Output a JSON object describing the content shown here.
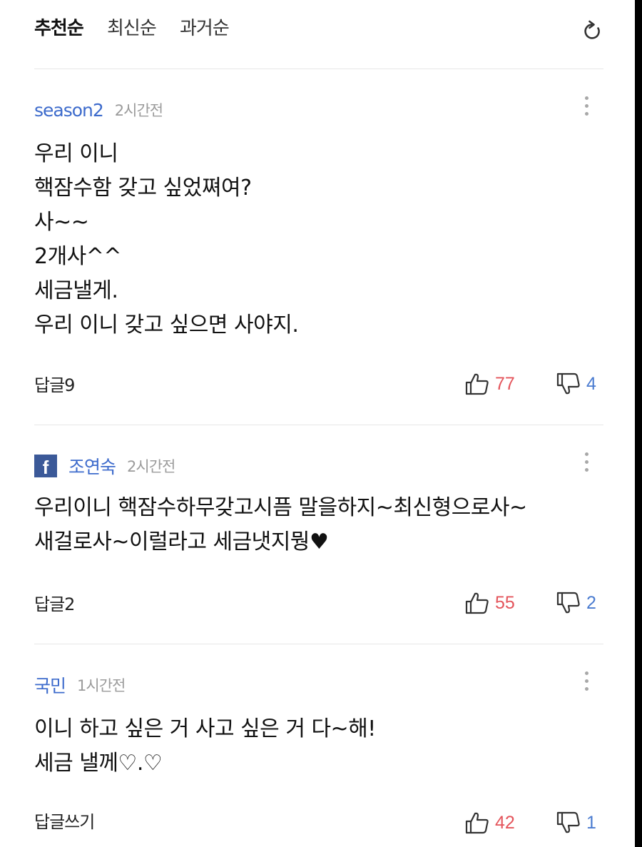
{
  "sort": {
    "tabs": [
      "추천순",
      "최신순",
      "과거순"
    ],
    "active_index": 0
  },
  "icons": {
    "refresh": "refresh-icon",
    "more": "more-vertical-icon",
    "like": "thumbs-up-icon",
    "dislike": "thumbs-down-icon",
    "facebook": "facebook-icon"
  },
  "colors": {
    "author": "#3d6bcc",
    "like_count": "#e4555c",
    "dislike_count": "#4a7bd0",
    "facebook": "#3b5998"
  },
  "comments": [
    {
      "author": "season2",
      "time": "2시간전",
      "facebook": false,
      "text": "우리 이니\n핵잠수함 갖고 싶었쪄여?\n사~~\n2개사^^\n세금낼게.\n우리 이니 갖고 싶으면 사야지.",
      "reply_label": "답글9",
      "likes": "77",
      "dislikes": "4"
    },
    {
      "author": "조연숙",
      "time": "2시간전",
      "facebook": true,
      "facebook_letter": "f",
      "text": "우리이니 핵잠수하무갖고시픔 말을하지~최신형으로사~\n새걸로사~이럴라고 세금냇지뭥♥",
      "reply_label": "답글2",
      "likes": "55",
      "dislikes": "2"
    },
    {
      "author": "국민",
      "time": "1시간전",
      "facebook": false,
      "text": "이니 하고 싶은 거 사고 싶은 거 다~해!\n세금 낼께♡.♡",
      "reply_label": "답글쓰기",
      "likes": "42",
      "dislikes": "1"
    }
  ]
}
